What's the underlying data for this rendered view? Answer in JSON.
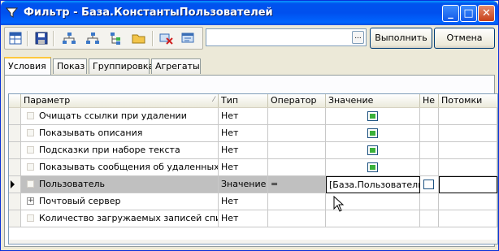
{
  "window": {
    "title": "Фильтр - База.КонстантыПользователей",
    "controls": {
      "minimize": "_",
      "maximize": "□",
      "close": "✕"
    }
  },
  "toolbar": {
    "icons": [
      "table-icon",
      "save-icon",
      "tree-icon",
      "tree-add-icon",
      "tree-branch-icon",
      "open-folder-icon",
      "delete-icon",
      "properties-icon"
    ],
    "path_value": "",
    "ellipsis": "...",
    "execute_label": "Выполнить",
    "cancel_label": "Отмена"
  },
  "tabs": [
    {
      "label": "Условия",
      "active": true
    },
    {
      "label": "Показ",
      "active": false
    },
    {
      "label": "Группировка",
      "active": false
    },
    {
      "label": "Агрегаты",
      "active": false
    }
  ],
  "grid": {
    "columns": {
      "param": "Параметр",
      "type": "Тип",
      "operator": "Оператор",
      "value": "Значение",
      "not": "Не",
      "children": "Потомки"
    },
    "sort_indicator": "⁄",
    "rows": [
      {
        "param": "Очищать ссылки при удалении",
        "type": "Нет",
        "operator": "",
        "value": "",
        "flag": true,
        "not": "",
        "children": "",
        "expander": ""
      },
      {
        "param": "Показывать описания",
        "type": "Нет",
        "operator": "",
        "value": "",
        "flag": true,
        "not": "",
        "children": "",
        "expander": ""
      },
      {
        "param": "Подсказки при наборе текста",
        "type": "Нет",
        "operator": "",
        "value": "",
        "flag": true,
        "not": "",
        "children": "",
        "expander": ""
      },
      {
        "param": "Показывать сообщения об удаленных",
        "type": "Нет",
        "operator": "",
        "value": "",
        "flag": true,
        "not": "",
        "children": "",
        "expander": ""
      },
      {
        "param": "Пользователь",
        "type": "Значение",
        "operator": "=",
        "value": "[База.Пользователь]",
        "flag": false,
        "not": "",
        "children": "",
        "expander": "",
        "selected": true
      },
      {
        "param": "Почтовый сервер",
        "type": "Нет",
        "operator": "",
        "value": "",
        "flag": false,
        "not": "",
        "children": "",
        "expander": "+"
      },
      {
        "param": "Количество загружаемых записей списка",
        "type": "Нет",
        "operator": "",
        "value": "",
        "flag": false,
        "not": "",
        "children": "",
        "expander": ""
      }
    ]
  }
}
